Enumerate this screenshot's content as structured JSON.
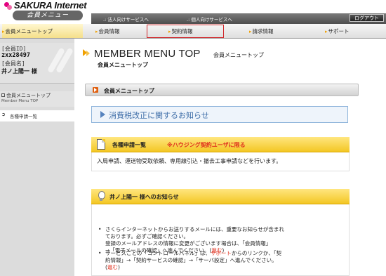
{
  "header": {
    "brand": "SAKURA Internet",
    "brand_sub": "会員メニュー",
    "service_corp": ".: 法人向けサービスへ",
    "service_personal": ".: 個人向けサービスへ",
    "logout": "ログアウト"
  },
  "nav": {
    "items": [
      {
        "label": "会員メニュートップ",
        "active": true
      },
      {
        "label": "会員情報"
      },
      {
        "label": "契約情報",
        "highlighted": true
      },
      {
        "label": "請求情報"
      },
      {
        "label": "サポート"
      }
    ],
    "highlight_color": "#d0262a"
  },
  "sidebar": {
    "id_label": "[会員ID]",
    "id_value": "zxx28497",
    "name_label": "[会員名]",
    "name_value": "井ノ上陽一 様",
    "top_label": "会員メニュートップ",
    "top_sub": "Member Menu TOP",
    "apps_label": "各種申請一覧"
  },
  "main": {
    "title": "MEMBER MENU TOP",
    "title_jp": "会員メニュートップ",
    "title_sub": "会員メニュートップ",
    "section_label": "会員メニュートップ",
    "notice": "消費税改正に関するお知らせ",
    "applications": {
      "title": "各種申請一覧",
      "note": "※ハウジング契約ユーザに限る",
      "description": "入局申請、運送物受取依頼、専用線引込・撤去工事申請などを行います。"
    },
    "user_notices": {
      "title": "井ノ上陽一 様へのお知らせ",
      "items": [
        {
          "line1": "さくらインターネットからお送りするメールには、重要なお知らせが含まれ",
          "line2": "ております。必ずご確認ください。",
          "line3": "登録のメールアドレスの情報に変更がございます場合は、「会員情報」",
          "line4_pre": "→「電子メールの確認」へ進んでください。(",
          "line4_link": "進む",
          "line4_post": ")"
        },
        {
          "line1_pre": "サービスごとの「コントロールパネル」は、",
          "line1_link": "サポート",
          "line1_post": "からのリンクか、「契",
          "line2": "約情報」→「契約サービスの確認」→「サーバ設定」へ進んでください。",
          "line3_pre": "(",
          "line3_link": "進む",
          "line3_post": ")"
        }
      ]
    }
  },
  "colors": {
    "accent_orange": "#f0a000",
    "header_yellow": "#f3c724",
    "notice_blue": "#3f6ea8",
    "link_red": "#e0301e"
  }
}
